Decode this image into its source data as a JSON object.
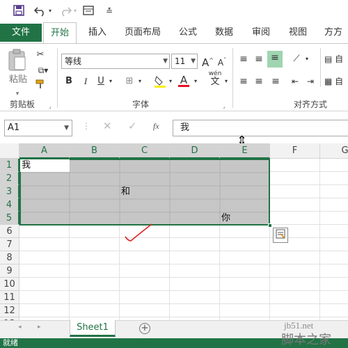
{
  "quick_access": {
    "save_icon": "save-icon",
    "undo_icon": "undo-icon",
    "redo_icon": "redo-icon",
    "form_icon": "form-icon",
    "customize_icon": "customize-qat-icon"
  },
  "ribbon_tabs": {
    "file": "文件",
    "home": "开始",
    "insert": "插入",
    "page_layout": "页面布局",
    "formulas": "公式",
    "data": "数据",
    "review": "审阅",
    "view": "视图",
    "more": "方方格"
  },
  "clipboard": {
    "paste_label": "粘贴",
    "group_label": "剪贴板"
  },
  "font": {
    "font_name": "等线",
    "font_size": "11",
    "bold": "B",
    "italic": "I",
    "underline": "U",
    "grow": "A",
    "shrink": "A",
    "font_color_letter": "A",
    "wen": "wén",
    "wen_char": "文",
    "group_label": "字体"
  },
  "alignment": {
    "group_label": "对齐方式",
    "wrap_label": "自"
  },
  "formula_bar": {
    "name_box": "A1",
    "fx_label": "fx",
    "formula_value": "我"
  },
  "sheet": {
    "columns": [
      "A",
      "B",
      "C",
      "D",
      "E",
      "F",
      "G"
    ],
    "rows": [
      "1",
      "2",
      "3",
      "4",
      "5",
      "6",
      "7",
      "8",
      "9",
      "10",
      "11",
      "12",
      "13"
    ],
    "cells": {
      "A1": "我",
      "C3": "和",
      "E5": "你"
    }
  },
  "sheet_tabs": {
    "active": "Sheet1",
    "add": "+"
  },
  "status_bar": {
    "text": "就绪"
  },
  "watermark": {
    "site": "jb51.net",
    "brand": "脚本之家"
  }
}
